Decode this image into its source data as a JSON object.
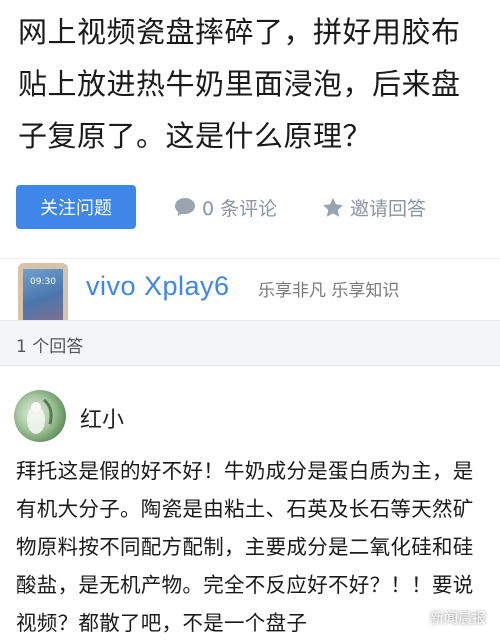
{
  "question": {
    "title": "网上视频瓷盘摔碎了，拼好用胶布贴上放进热牛奶里面浸泡，后来盘子复原了。这是什么原理？"
  },
  "actions": {
    "follow_label": "关注问题",
    "comments_label": "0 条评论",
    "invite_label": "邀请回答",
    "comment_icon": "speech-bubble-icon",
    "invite_icon": "star-icon"
  },
  "ad": {
    "phone_time": "09:30",
    "brand": "vivo Xplay6",
    "slogan": "乐享非凡 乐享知识"
  },
  "answers": {
    "count_label": "1 个回答"
  },
  "answer": {
    "author": "红小",
    "body": "拜托这是假的好不好！牛奶成分是蛋白质为主，是有机大分子。陶瓷是由粘土、石英及长石等天然矿物原料按不同配方配制，主要成分是二氧化硅和硅酸盐，是无机产物。完全不反应好不好？！！要说视频？都散了吧，不是一个盘子"
  },
  "watermark": {
    "label": "新闻晨报"
  },
  "colors": {
    "accent": "#3e86e8",
    "muted": "#8a94a3",
    "section_bg": "#f4f5f7"
  }
}
